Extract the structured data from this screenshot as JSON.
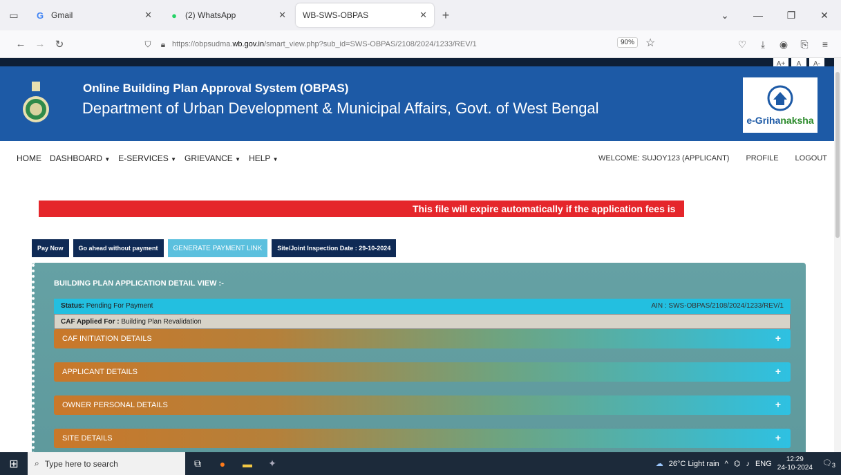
{
  "browser": {
    "tab_list_icon": "tab-list-icon",
    "tabs": [
      {
        "label": "Gmail",
        "favicon": "G"
      },
      {
        "label": "(2) WhatsApp",
        "favicon": "●"
      },
      {
        "label": "WB-SWS-OBPAS",
        "favicon": ""
      }
    ],
    "url_host_prefix": "https://obpsudma.",
    "url_host": "wb.gov.in",
    "url_path": "/smart_view.php?sub_id=SWS-OBPAS/2108/2024/1233/REV/1",
    "zoom": "90%"
  },
  "site": {
    "accessibility": [
      "A+",
      "A",
      "A-"
    ],
    "title_line1": "Online Building Plan Approval System (OBPAS)",
    "title_line2": "Department of Urban Development & Municipal Affairs, Govt. of West Bengal",
    "logo_text_a": "e-Griha",
    "logo_text_b": "naksha"
  },
  "menu": {
    "home": "HOME",
    "dashboard": "DASHBOARD",
    "eservices": "E-SERVICES",
    "grievance": "GRIEVANCE",
    "help": "HELP",
    "welcome": "WELCOME: SUJOY123 (APPLICANT)",
    "profile": "PROFILE",
    "logout": "LOGOUT"
  },
  "notice": "This file will expire automatically if the application fees is",
  "actions": {
    "pay_now": "Pay Now",
    "go_ahead": "Go ahead without payment",
    "generate_link": "GENERATE PAYMENT LINK",
    "inspection": "Site/Joint Inspection Date : 29-10-2024"
  },
  "panel": {
    "title": "BUILDING PLAN APPLICATION DETAIL VIEW :-",
    "status_label": "Status:",
    "status_value": "Pending For Payment",
    "ain": "AIN : SWS-OBPAS/2108/2024/1233/REV/1",
    "caf_label": "CAF Applied For :",
    "caf_value": "Building Plan Revalidation",
    "sections": [
      "CAF INITIATION DETAILS",
      "APPLICANT DETAILS",
      "OWNER PERSONAL DETAILS",
      "SITE DETAILS"
    ]
  },
  "taskbar": {
    "search_placeholder": "Type here to search",
    "weather": "26°C  Light rain",
    "lang": "ENG",
    "time": "12:29",
    "date": "24-10-2024",
    "notification_count": "3"
  }
}
